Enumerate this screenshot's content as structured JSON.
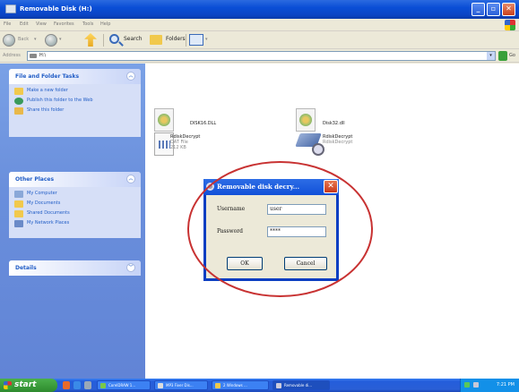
{
  "window": {
    "title": "Removable Disk (H:)",
    "btn_min": "_",
    "btn_max": "▫",
    "btn_close": "✕"
  },
  "menu": [
    "File",
    "Edit",
    "View",
    "Favorites",
    "Tools",
    "Help"
  ],
  "toolbar": {
    "back_label": "Back",
    "search_label": "Search",
    "folders_label": "Folders"
  },
  "address": {
    "label": "Address",
    "value": "H:\\",
    "go_label": "Go"
  },
  "panes": {
    "tasks": {
      "title": "File and Folder Tasks",
      "items": [
        "Make a new folder",
        "Publish this folder to the Web",
        "Share this folder"
      ]
    },
    "places": {
      "title": "Other Places",
      "items": [
        "My Computer",
        "My Documents",
        "Shared Documents",
        "My Network Places"
      ]
    },
    "details": {
      "title": "Details"
    }
  },
  "files": [
    {
      "name": "DISK16.DLL",
      "type": "",
      "size": ""
    },
    {
      "name": "Disk32.dll",
      "type": "",
      "size": ""
    },
    {
      "name": "RdiskDecrypt",
      "type": "DAT File",
      "size": "212 KB"
    },
    {
      "name": "RdiskDecrypt",
      "type": "RdiskDecrypt",
      "size": ""
    }
  ],
  "dialog": {
    "title": "Removable disk decry...",
    "username_label": "Username",
    "username_value": "user",
    "password_label": "Password",
    "password_value": "****",
    "ok_label": "OK",
    "cancel_label": "Cancel"
  },
  "taskbar": {
    "start_label": "start",
    "tasks": [
      {
        "label": "CorelDRAW 1...",
        "active": false
      },
      {
        "label": "MP3 Fiver Dis...",
        "active": false
      },
      {
        "label": "2 Windows ...",
        "active": false
      },
      {
        "label": "Removable di...",
        "active": true
      }
    ],
    "clock": "7:21 PM"
  },
  "colors": {
    "xp_blue": "#0a4ed6",
    "annotation_red": "#c83232",
    "start_green": "#3a9c3a"
  }
}
